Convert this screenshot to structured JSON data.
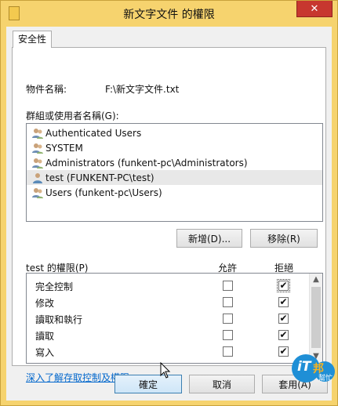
{
  "window": {
    "title": "新文字文件 的權限",
    "close_glyph": "✕",
    "folder_icon": "folder-icon"
  },
  "tabs": [
    {
      "label": "安全性"
    }
  ],
  "object": {
    "label": "物件名稱:",
    "value": "F:\\新文字文件.txt"
  },
  "groups": {
    "label": "群組或使用者名稱(G):",
    "items": [
      {
        "label": "Authenticated Users",
        "icon": "users-group-icon"
      },
      {
        "label": "SYSTEM",
        "icon": "users-group-icon"
      },
      {
        "label": "Administrators (funkent-pc\\Administrators)",
        "icon": "users-group-icon"
      },
      {
        "label": "test (FUNKENT-PC\\test)",
        "icon": "user-icon",
        "selected": true
      },
      {
        "label": "Users (funkent-pc\\Users)",
        "icon": "users-group-icon"
      }
    ]
  },
  "buttons": {
    "add": "新增(D)...",
    "remove": "移除(R)",
    "ok": "確定",
    "cancel": "取消",
    "apply": "套用(A)"
  },
  "permissions": {
    "label": "test 的權限(P)",
    "allow_header": "允許",
    "deny_header": "拒絕",
    "rows": [
      {
        "name": "完全控制",
        "allow": false,
        "deny": true,
        "focused": true
      },
      {
        "name": "修改",
        "allow": false,
        "deny": true
      },
      {
        "name": "讀取和執行",
        "allow": false,
        "deny": true
      },
      {
        "name": "讀取",
        "allow": false,
        "deny": true
      },
      {
        "name": "寫入",
        "allow": false,
        "deny": true
      }
    ]
  },
  "link": "深入了解存取控制及權限",
  "watermark": {
    "brand": "iT",
    "sub": "邦",
    "tag": "幫忙"
  },
  "colors": {
    "title_bar": "#f6d36e",
    "close": "#c7372f",
    "link": "#0066cc"
  }
}
